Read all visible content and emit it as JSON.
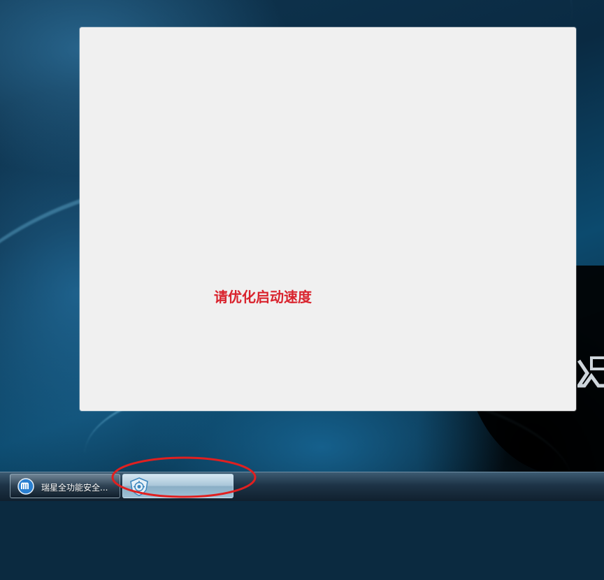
{
  "splash": {
    "message": "请优化启动速度",
    "message_color": "#d9232d"
  },
  "taskbar": {
    "items": [
      {
        "label": "瑞星全功能安全...",
        "icon": "maxthon-m-icon"
      },
      {
        "label": "",
        "icon": "shield-app-icon",
        "active": true
      }
    ]
  },
  "annotation": {
    "shape": "ellipse",
    "color": "#e02020",
    "target": "taskbar-item-2"
  }
}
